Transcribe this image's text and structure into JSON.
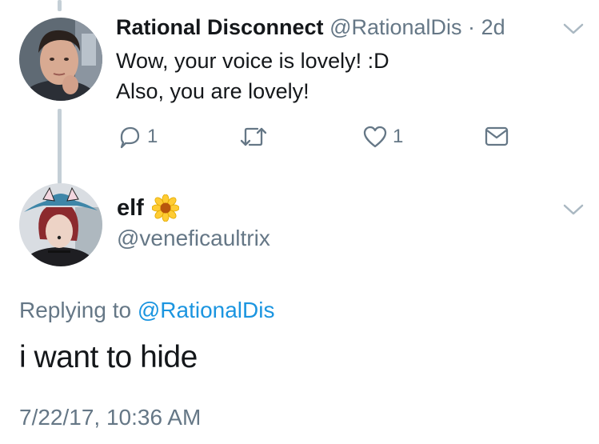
{
  "parent_tweet": {
    "display_name": "Rational Disconnect",
    "handle": "@RationalDis",
    "separator": "·",
    "age": "2d",
    "text_line1": "Wow, your voice is lovely! :D",
    "text_line2": "Also, you are lovely!",
    "reply_count": "1",
    "like_count": "1"
  },
  "reply_tweet": {
    "display_name": "elf",
    "name_emoji": "sunflower",
    "handle": "@veneficaultrix",
    "replying_label": "Replying to",
    "replying_to": "@RationalDis",
    "text": "i want to hide",
    "timestamp": "7/22/17, 10:36 AM"
  },
  "colors": {
    "text": "#14171a",
    "secondary": "#657786",
    "link": "#1b95e0",
    "thread_line": "#c4cfd6"
  }
}
